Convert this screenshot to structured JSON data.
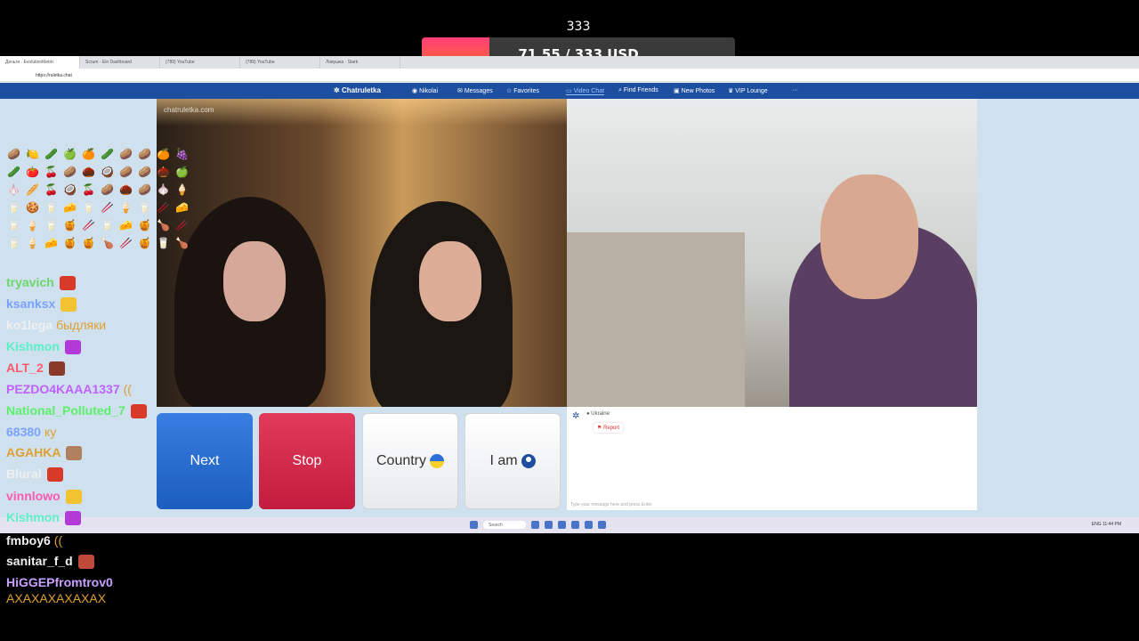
{
  "goal": {
    "target_label": "333",
    "text": "71.55 / 333 USD",
    "progress": 0.215,
    "min": "0",
    "max": "333",
    "fill_color": "#ff4f6a"
  },
  "browser": {
    "tabs": [
      "Деньги · EvolutionMetric",
      "Scrum · Еin Dashboard",
      "(789) YouTube",
      "(789) YouTube",
      "Ловушка · Stark"
    ],
    "url": "https://ruletka.chat"
  },
  "site_nav": {
    "brand": "Chatruletka",
    "user": "Nikolai",
    "messages": "Messages",
    "favorites": "Favorites",
    "video_chat": "Video Chat",
    "find_friends": "Find Friends",
    "new_photos": "New Photos",
    "vip_lounge": "VIP Lounge",
    "more": "···"
  },
  "video": {
    "watermark": "chatruletka.com"
  },
  "controls": {
    "next": "Next",
    "stop": "Stop",
    "country": "Country",
    "iam": "I am"
  },
  "chat_panel": {
    "country_chip": "Ukraine",
    "report": "Report",
    "placeholder": "Type your message here and press Enter"
  },
  "taskbar": {
    "search": "Search",
    "tray": "ENG  11:44 PM"
  },
  "stream_chat": [
    {
      "user": "tryavich",
      "color": "#6cd86c",
      "msg": "",
      "emote": "#d83a2a"
    },
    {
      "user": "ksanksx",
      "color": "#7aa2ff",
      "msg": "",
      "emote": "#f2c230"
    },
    {
      "user": "ko1lega",
      "color": "#f0f0f0",
      "msg": "быдляки",
      "msg_color": "#e0a030"
    },
    {
      "user": "Kishmon",
      "color": "#5cf0c8",
      "msg": "",
      "emote": "#b43ad8"
    },
    {
      "user": "ALT_2",
      "color": "#ff5a6a",
      "msg": "",
      "emote": "#8a3a2a"
    },
    {
      "user": "PEZDO4KAAA1337",
      "color": "#c060ff",
      "msg": "((",
      "msg_color": "#e0a030"
    },
    {
      "user": "National_Polluted_7",
      "color": "#5cf06a",
      "msg": "",
      "emote": "#d83a2a"
    },
    {
      "user": "68380",
      "color": "#7aa2ff",
      "msg": "ку",
      "msg_color": "#e0a030"
    },
    {
      "user": "AGAHKA",
      "color": "#e0a030",
      "msg": "",
      "emote": "#b08060"
    },
    {
      "user": "Blural",
      "color": "#f0f0f0",
      "msg": "",
      "emote": "#d83a2a"
    },
    {
      "user": "vinnlowo",
      "color": "#ff5ab0",
      "msg": "",
      "emote": "#f2c230"
    },
    {
      "user": "Kishmon",
      "color": "#5cf0c8",
      "msg": "",
      "emote": "#b43ad8"
    },
    {
      "user": "fmboy6",
      "color": "#f0f0f0",
      "msg": "((",
      "msg_color": "#e0a030"
    },
    {
      "user": "sanitar_f_d",
      "color": "#f0f0f0",
      "msg": "",
      "emote": "#c04a3a"
    },
    {
      "user": "HiGGEPfromtrov0",
      "color": "#c8a0ff",
      "msg": ""
    },
    {
      "user": "",
      "color": "#e0a030",
      "msg": "AXAXAXAXAXAX",
      "msg_color": "#e0a030"
    }
  ],
  "emotes": [
    "🥔",
    "🍋",
    "🥒",
    "🍏",
    "🍊",
    "🥒",
    "🥔",
    "🥔",
    "🍊",
    "🍇",
    "🥒",
    "🍅",
    "🍒",
    "🥔",
    "🌰",
    "🥥",
    "🥔",
    "🥔",
    "🌰",
    "🍏",
    "🧄",
    "🥖",
    "🍒",
    "🥥",
    "🍒",
    "🥔",
    "🌰",
    "🥔",
    "🧄",
    "🍦",
    "🥛",
    "🍪",
    "🥛",
    "🧀",
    "🥛",
    "🥢",
    "🍦",
    "🥛",
    "🥢",
    "🧀",
    "🥛",
    "🍦",
    "🥛",
    "🍯",
    "🥢",
    "🥛",
    "🧀",
    "🍯",
    "🍗",
    "🥢",
    "🥛",
    "🍦",
    "🧀",
    "🍯",
    "🍯",
    "🍗",
    "🥢",
    "🍯",
    "🥛",
    "🍗"
  ]
}
